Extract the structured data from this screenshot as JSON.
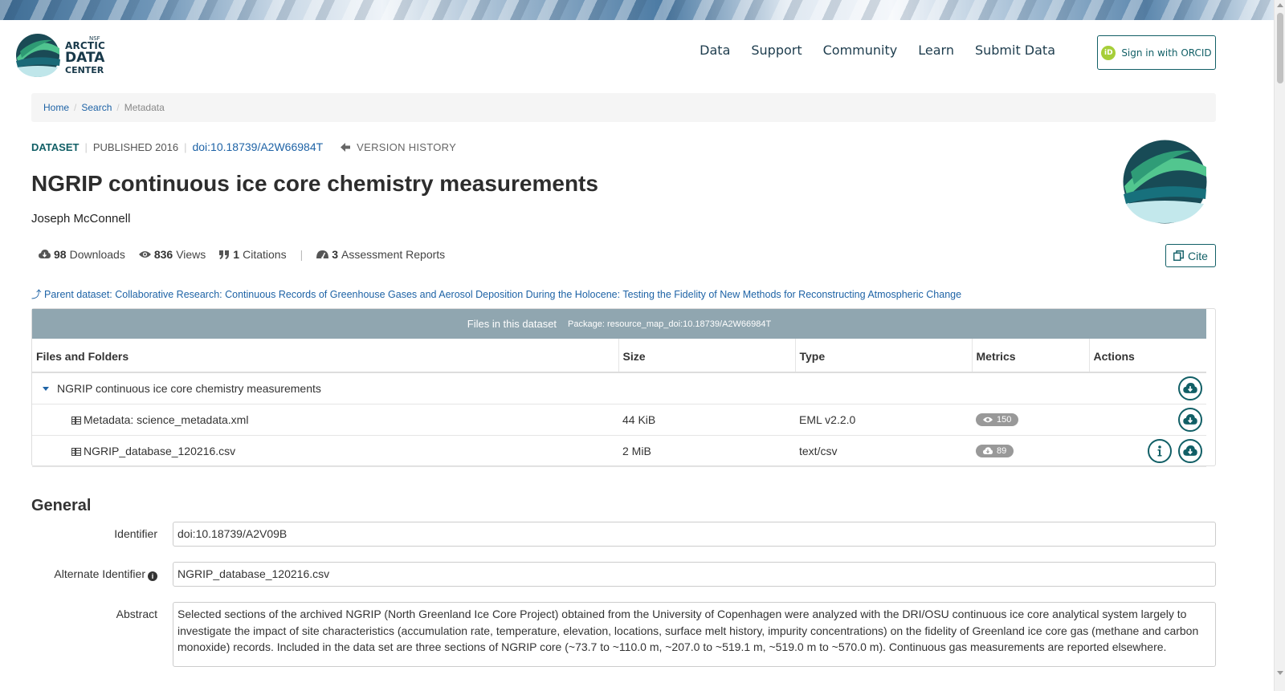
{
  "nav": {
    "logo": {
      "nsf": "NSF",
      "line1": "ARCTIC",
      "line2": "DATA",
      "line3": "CENTER"
    },
    "menu": [
      "Data",
      "Support",
      "Community",
      "Learn",
      "Submit Data"
    ],
    "orcid": {
      "icon": "iD",
      "label": "Sign in with ORCID"
    }
  },
  "breadcrumb": {
    "home": "Home",
    "search": "Search",
    "current": "Metadata"
  },
  "dataset": {
    "type": "DATASET",
    "published": "PUBLISHED 2016",
    "doi": "doi:10.18739/A2W66984T",
    "version_history": "VERSION HISTORY",
    "title": "NGRIP continuous ice core chemistry measurements",
    "author": "Joseph McConnell"
  },
  "metrics": {
    "downloads_count": "98",
    "downloads_label": "Downloads",
    "views_count": "836",
    "views_label": "Views",
    "citations_count": "1",
    "citations_label": "Citations",
    "reports_count": "3",
    "reports_label": "Assessment Reports"
  },
  "cite_label": "Cite",
  "parent": "Parent dataset: Collaborative Research: Continuous Records of Greenhouse Gases and Aerosol Deposition During the Holocene: Testing the Fidelity of New Methods for Reconstructing Atmospheric Change",
  "files": {
    "header": "Files in this dataset",
    "package": "Package: resource_map_doi:10.18739/A2W66984T",
    "columns": [
      "Files and Folders",
      "Size",
      "Type",
      "Metrics",
      "Actions"
    ],
    "folder": "NGRIP continuous ice core chemistry measurements",
    "rows": [
      {
        "name": "Metadata: science_metadata.xml",
        "size": "44 KiB",
        "type": "EML v2.2.0",
        "metric_icon": "eye-icon",
        "metric": "150"
      },
      {
        "name": "NGRIP_database_120216.csv",
        "size": "2 MiB",
        "type": "text/csv",
        "metric_icon": "cloud-download-icon",
        "metric": "89"
      }
    ]
  },
  "general": {
    "title": "General",
    "identifier_label": "Identifier",
    "identifier": "doi:10.18739/A2V09B",
    "alt_identifier_label": "Alternate Identifier",
    "alt_identifier": "NGRIP_database_120216.csv",
    "abstract_label": "Abstract",
    "abstract": "Selected sections of the archived NGRIP (North Greenland Ice Core Project) obtained from the University of Copenhagen were analyzed with the DRI/OSU continuous ice core analytical system largely to investigate the impact of site characteristics (accumulation rate, temperature, elevation, locations, surface melt history, impurity concentrations) on the fidelity of Greenland ice core gas (methane and carbon monoxide) records. Included in the data set are three sections of NGRIP core (~73.7 to ~110.0 m, ~207.0 to ~519.1 m, ~519.0 m to ~570.0 m). Continuous gas measurements are reported elsewhere."
  },
  "colors": {
    "accent": "#115f66",
    "link": "#1e63a6",
    "files_header": "#90a6b0"
  }
}
